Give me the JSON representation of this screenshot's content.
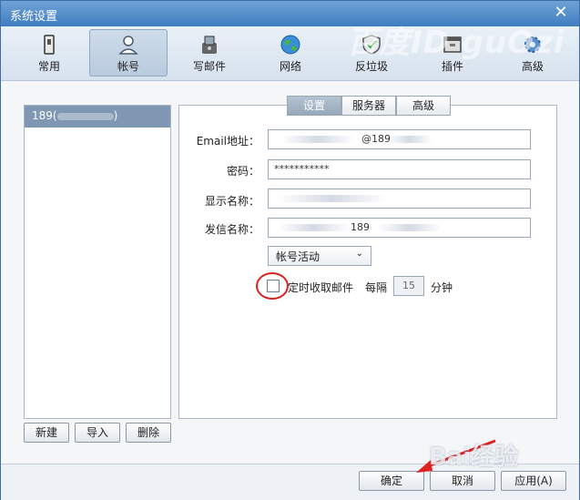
{
  "window": {
    "title": "系统设置"
  },
  "watermark_top": "百度ID guOzi",
  "toolbar": {
    "items": [
      {
        "label": "常用",
        "icon": "device-icon"
      },
      {
        "label": "帐号",
        "icon": "user-icon"
      },
      {
        "label": "写邮件",
        "icon": "compose-icon"
      },
      {
        "label": "网络",
        "icon": "globe-icon"
      },
      {
        "label": "反垃圾",
        "icon": "shield-icon"
      },
      {
        "label": "插件",
        "icon": "plugin-icon"
      },
      {
        "label": "高级",
        "icon": "gear-icon"
      }
    ],
    "active_index": 1
  },
  "accounts": {
    "items": [
      "189("
    ],
    "items_suffix": ")"
  },
  "left_buttons": {
    "new": "新建",
    "import": "导入",
    "delete": "删除"
  },
  "tabs": {
    "items": [
      "设置",
      "服务器",
      "高级"
    ],
    "active_index": 0
  },
  "form": {
    "email_label": "Email地址：",
    "email_value": "@189",
    "password_label": "密码：",
    "password_value": "***********",
    "display_name_label": "显示名称：",
    "sender_name_label": "发信名称：",
    "sender_name_value": "189",
    "account_status": "帐号活动",
    "auto_fetch_label": "定时收取邮件",
    "interval_prefix": "每隔",
    "interval_value": "15",
    "interval_unit": "分钟"
  },
  "bottom": {
    "ok": "确定",
    "cancel": "取消",
    "apply": "应用(A)"
  },
  "baidu_watermark": "Bai经验",
  "colors": {
    "accent": "#3f7cc0",
    "selected": "#7f97b2",
    "annotation": "#dd2222"
  }
}
